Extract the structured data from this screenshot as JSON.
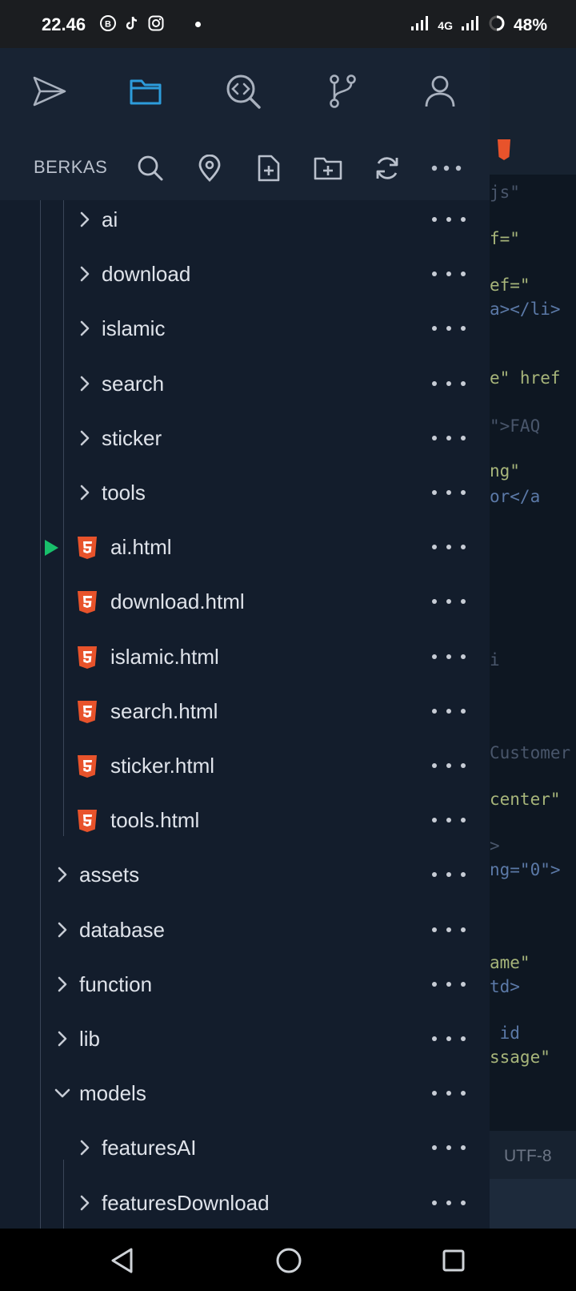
{
  "status_bar": {
    "time": "22.46",
    "network": "4G",
    "battery": "48%",
    "notification_icons": [
      "b-circle-icon",
      "tiktok-icon",
      "instagram-icon"
    ]
  },
  "drawer": {
    "top_nav": [
      {
        "name": "send-icon",
        "active": false
      },
      {
        "name": "folder-icon",
        "active": true
      },
      {
        "name": "code-search-icon",
        "active": false
      },
      {
        "name": "git-branch-icon",
        "active": false
      },
      {
        "name": "user-icon",
        "active": false
      }
    ],
    "toolbar_title": "BERKAS",
    "toolbar_icons": [
      "search-icon",
      "location-pin-icon",
      "new-file-icon",
      "new-folder-icon",
      "refresh-icon",
      "more-icon"
    ],
    "tree": [
      {
        "label": "ai",
        "type": "folder",
        "level": 2,
        "expanded": false
      },
      {
        "label": "download",
        "type": "folder",
        "level": 2,
        "expanded": false
      },
      {
        "label": "islamic",
        "type": "folder",
        "level": 2,
        "expanded": false
      },
      {
        "label": "search",
        "type": "folder",
        "level": 2,
        "expanded": false
      },
      {
        "label": "sticker",
        "type": "folder",
        "level": 2,
        "expanded": false
      },
      {
        "label": "tools",
        "type": "folder",
        "level": 2,
        "expanded": false
      },
      {
        "label": "ai.html",
        "type": "html",
        "level": 2,
        "running": true
      },
      {
        "label": "download.html",
        "type": "html",
        "level": 2
      },
      {
        "label": "islamic.html",
        "type": "html",
        "level": 2
      },
      {
        "label": "search.html",
        "type": "html",
        "level": 2
      },
      {
        "label": "sticker.html",
        "type": "html",
        "level": 2
      },
      {
        "label": "tools.html",
        "type": "html",
        "level": 2
      },
      {
        "label": "assets",
        "type": "folder",
        "level": 1,
        "expanded": false
      },
      {
        "label": "database",
        "type": "folder",
        "level": 1,
        "expanded": false
      },
      {
        "label": "function",
        "type": "folder",
        "level": 1,
        "expanded": false
      },
      {
        "label": "lib",
        "type": "folder",
        "level": 1,
        "expanded": false
      },
      {
        "label": "models",
        "type": "folder",
        "level": 1,
        "expanded": true
      },
      {
        "label": "featuresAI",
        "type": "folder",
        "level": 2,
        "expanded": false
      },
      {
        "label": "featuresDownload",
        "type": "folder",
        "level": 2,
        "expanded": false
      }
    ]
  },
  "editor": {
    "encoding": "UTF-8",
    "code_lines": [
      {
        "text": "js\"",
        "cls": "c-muted"
      },
      {
        "text": "f=\"",
        "cls": "c-str"
      },
      {
        "text": "ef=\"",
        "cls": "c-str"
      },
      {
        "text": "a></li>",
        "cls": "c-tag"
      },
      {
        "text": "e\" href",
        "cls": "c-str"
      },
      {
        "text": "\">FAQ",
        "cls": "c-muted"
      },
      {
        "text": "ng\"",
        "cls": "c-str"
      },
      {
        "text": "or</a",
        "cls": "c-tag"
      },
      {
        "text": "i",
        "cls": "c-muted"
      },
      {
        "text": "Customer",
        "cls": "c-muted"
      },
      {
        "text": "center\"",
        "cls": "c-str"
      },
      {
        "text": ">",
        "cls": "c-muted"
      },
      {
        "text": "ng=\"0\">",
        "cls": "c-tag"
      },
      {
        "text": "ame\"",
        "cls": "c-str"
      },
      {
        "text": "td>",
        "cls": "c-tag"
      },
      {
        "text": " id",
        "cls": "c-tag"
      },
      {
        "text": "ssage\"",
        "cls": "c-str"
      }
    ]
  },
  "colors": {
    "drawer_bg": "#131d2c",
    "header_bg": "#182333",
    "accent_blue": "#2d9cdb",
    "run_green": "#18c06b",
    "html_orange": "#e8532b"
  }
}
